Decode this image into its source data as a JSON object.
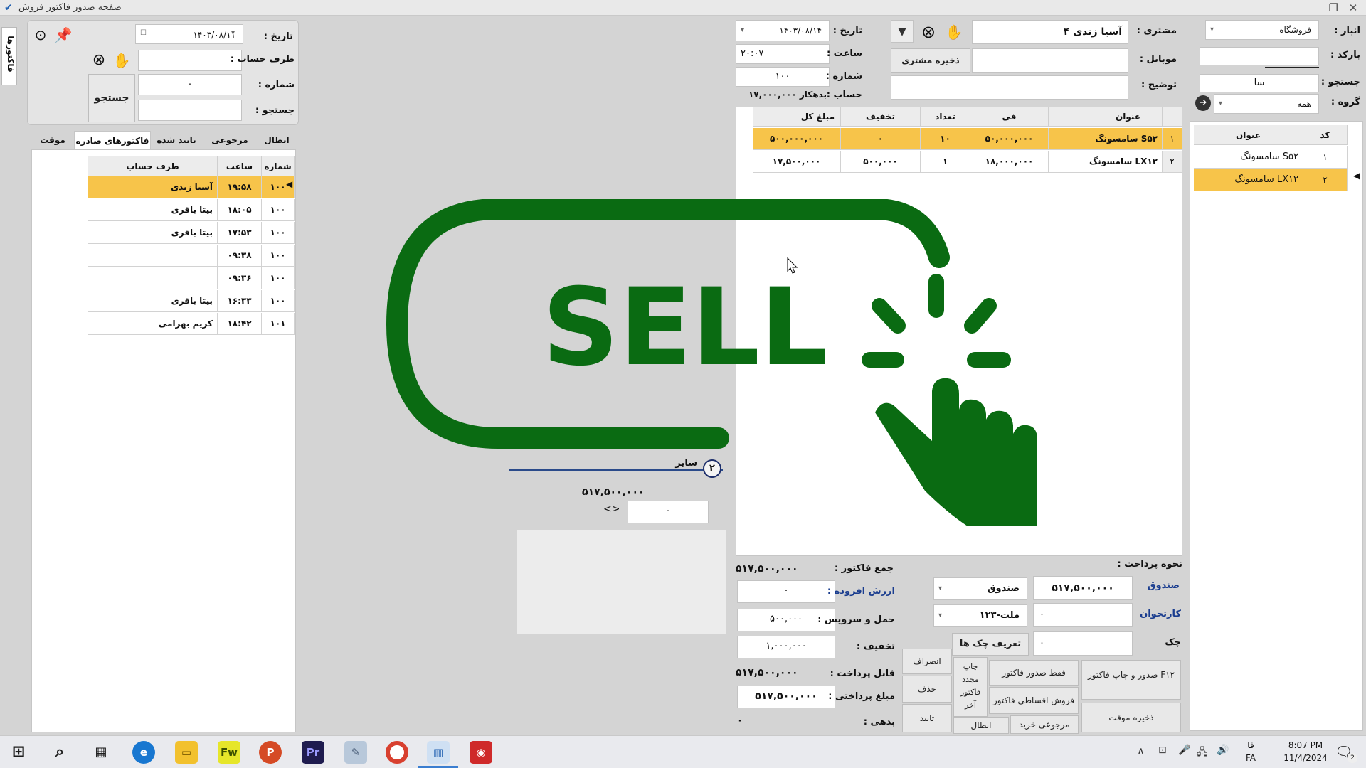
{
  "window": {
    "title": "صفحه صدور فاکتور فروش"
  },
  "side_tab": {
    "label": "فاکتورها"
  },
  "left_panel": {
    "date_label": "تاریخ :",
    "date_value": "۱۴۰۳/۰۸/۱۱",
    "account_label": "طرف حساب :",
    "number_label": "شماره :",
    "number_value": "۰",
    "search_label": "جستجو :",
    "search_button": "جستجو",
    "tabs": [
      "ابطال",
      "مرجوعی خرید",
      "تایید شده",
      "فاکتورهای صادره",
      "موقت"
    ],
    "columns": [
      "شماره",
      "ساعت",
      "طرف حساب"
    ],
    "rows": [
      {
        "number": "۱۰۰",
        "time": "۱۹:۵۸",
        "account": "آسیا زندی"
      },
      {
        "number": "۱۰۰",
        "time": "۱۸:۰۵",
        "account": "بیتا باقری"
      },
      {
        "number": "۱۰۰",
        "time": "۱۷:۵۳",
        "account": "بیتا باقری"
      },
      {
        "number": "۱۰۰",
        "time": "۰۹:۳۸",
        "account": ""
      },
      {
        "number": "۱۰۰",
        "time": "۰۹:۳۶",
        "account": ""
      },
      {
        "number": "۱۰۰",
        "time": "۱۶:۳۳",
        "account": "بیتا باقری"
      },
      {
        "number": "۱۰۱",
        "time": "۱۸:۴۲",
        "account": "کریم بهرامی"
      }
    ]
  },
  "middle": {
    "other_badge": "۲",
    "other_label": "سایر",
    "amount": "۵۱۷,۵۰۰,۰۰۰",
    "arrow_label": "<>",
    "input_value": "۰"
  },
  "invoice": {
    "date_label": "تاریخ :",
    "date_value": "۱۴۰۳/۰۸/۱۴",
    "time_label": "ساعت :",
    "time_value": "۲۰:۰۷",
    "number_label": "شماره :",
    "number_value": "۱۰۰",
    "account_label": "حساب :",
    "account_value": "بدهکار ۱۷,۰۰۰,۰۰۰",
    "customer_label": "مشتری :",
    "customer_value": "۴  آسیا زندی",
    "mobile_label": "موبایل :",
    "save_customer_button": "ذخیره مشتری جدید",
    "description_label": "توضیح :",
    "columns": [
      "عنوان",
      "فی",
      "تعداد",
      "تخفیف",
      "مبلغ کل"
    ],
    "rows": [
      {
        "idx": "۱",
        "title": "سامسونگ S۵۲",
        "price": "۵۰,۰۰۰,۰۰۰",
        "qty": "۱۰",
        "discount": "۰",
        "total": "۵۰۰,۰۰۰,۰۰۰"
      },
      {
        "idx": "۲",
        "title": "سامسونگ LX۱۲",
        "price": "۱۸,۰۰۰,۰۰۰",
        "qty": "۱",
        "discount": "۵۰۰,۰۰۰",
        "total": "۱۷,۵۰۰,۰۰۰"
      }
    ]
  },
  "totals": {
    "invoice_sum_label": "جمع فاکتور :",
    "invoice_sum_value": "۵۱۷,۵۰۰,۰۰۰",
    "vat_label": "ارزش افزوده :",
    "vat_value": "۰",
    "service_label": "حمل و سرویس :",
    "service_value": "۵۰۰,۰۰۰",
    "discount_label": "تخفیف :",
    "discount_value": "۱,۰۰۰,۰۰۰",
    "payable_label": "قابل پرداخت :",
    "payable_value": "۵۱۷,۵۰۰,۰۰۰",
    "paid_label": "مبلغ پرداختی :",
    "paid_value": "۵۱۷,۵۰۰,۰۰۰",
    "debt_label": "بدهی :",
    "debt_value": "۰"
  },
  "payment": {
    "heading": "نحوه پرداخت :",
    "cash_label": "صندوق",
    "cash_amount": "۵۱۷,۵۰۰,۰۰۰",
    "cash_select": "صندوق",
    "card_label": "کارتخوان",
    "card_amount": "۰",
    "card_select": "ملت-۱۲۳",
    "check_label": "چک",
    "check_amount": "۰",
    "define_checks_button": "تعریف چک ها"
  },
  "actions": {
    "issue_print": "صدور و چاپ فاکتور F۱۲",
    "issue_only": "فقط صدور فاکتور",
    "reprint": "چاپ مجدد فاکتور آخر",
    "cancel": "انصراف",
    "installment": "فروش اقساطی فاکتور",
    "delete": "حذف",
    "save_temp": "ذخیره موقت",
    "purchase_return": "مرجوعی خرید",
    "void": "ابطال",
    "confirm": "تایید"
  },
  "right_panel": {
    "warehouse_label": "انبار :",
    "warehouse_value": "فروشگاه",
    "barcode_label": "بارکد :",
    "search_label": "جستجو :",
    "search_value": "سا",
    "group_label": "گروه :",
    "group_value": "همه",
    "columns": [
      "کد",
      "عنوان"
    ],
    "rows": [
      {
        "code": "۱",
        "title": "سامسونگ S۵۲"
      },
      {
        "code": "۲",
        "title": "سامسونگ LX۱۲"
      }
    ]
  },
  "overlay": {
    "text": "SELL"
  },
  "taskbar": {
    "lang_top": "فا",
    "lang_bottom": "FA",
    "time": "8:07 PM",
    "date": "11/4/2024",
    "notif_count": "2",
    "apps": [
      "Fw",
      "P",
      "Pr"
    ]
  },
  "colors": {
    "highlight": "#f7c44a",
    "brand_green": "#0a6b12",
    "link_blue": "#1a3d8f"
  }
}
